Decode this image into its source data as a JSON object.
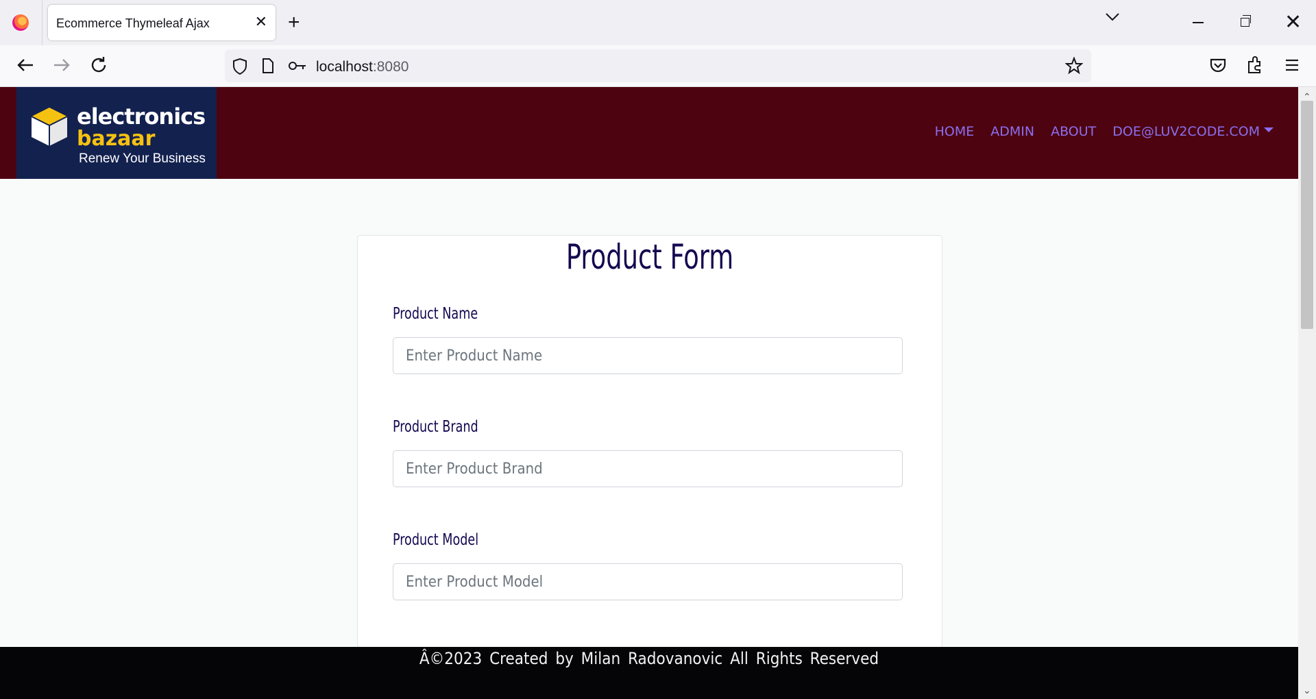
{
  "browser": {
    "tab_title": "Ecommerce Thymeleaf Ajax",
    "url_host": "localhost",
    "url_port": ":8080"
  },
  "site": {
    "logo": {
      "line1": "electronics",
      "line2": "bazaar",
      "tagline": "Renew Your Business"
    },
    "menu": [
      "HOME",
      "ADMIN",
      "ABOUT",
      "DOE@LUV2CODE.COM"
    ]
  },
  "form": {
    "title": "Product Form",
    "fields": [
      {
        "label": "Product Name",
        "placeholder": "Enter Product Name",
        "value": ""
      },
      {
        "label": "Product Brand",
        "placeholder": "Enter Product Brand",
        "value": ""
      },
      {
        "label": "Product Model",
        "placeholder": "Enter Product Model",
        "value": ""
      }
    ]
  },
  "footer": {
    "text": "Â©2023   Created by Milan Radovanovic    All Rights Reserved"
  },
  "colors": {
    "header_bg": "#4e0410",
    "logo_bg": "#13214f",
    "menu_text": "#8a6ff0",
    "title_text": "#150850",
    "footer_bg": "#050508"
  }
}
